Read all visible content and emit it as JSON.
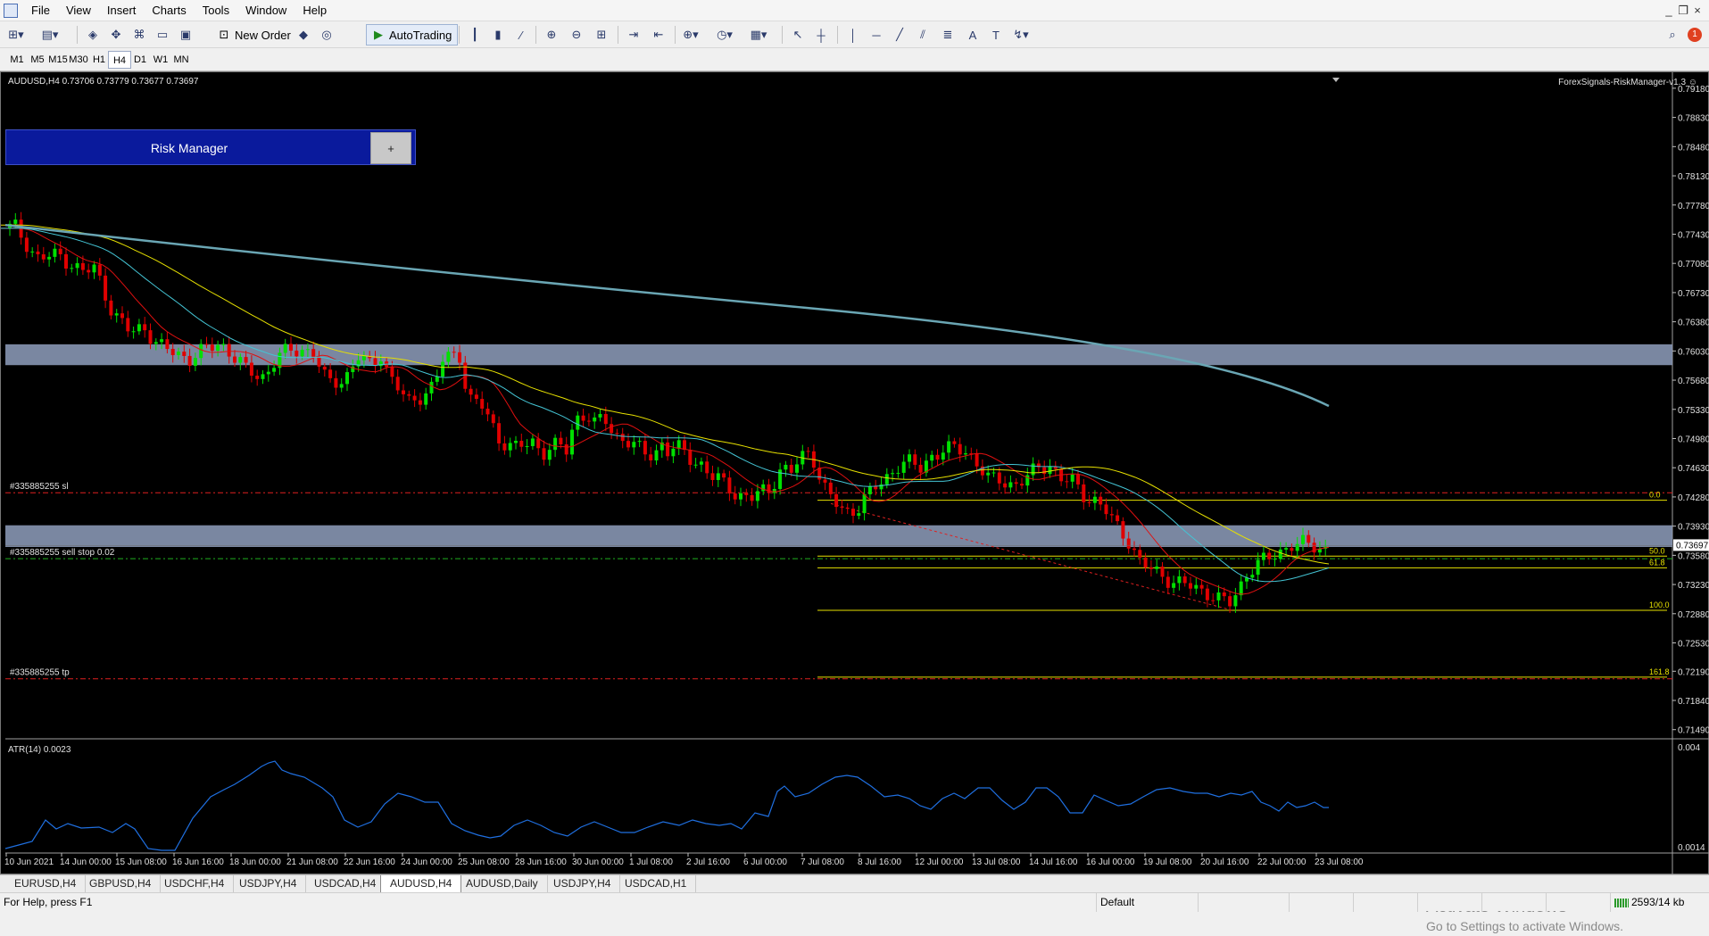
{
  "menu": {
    "items": [
      "File",
      "View",
      "Insert",
      "Charts",
      "Tools",
      "Window",
      "Help"
    ]
  },
  "window_controls": [
    "_",
    "❐",
    "×"
  ],
  "toolbar": {
    "new_order_label": "New Order",
    "autotrading_label": "AutoTrading",
    "notification_count": "1"
  },
  "timeframes": {
    "items": [
      "M1",
      "M5",
      "M15",
      "M30",
      "H1",
      "H4",
      "D1",
      "W1",
      "MN"
    ],
    "active": "H4"
  },
  "chart": {
    "symbol_info": "AUDUSD,H4  0.73706 0.73779 0.73677 0.73697",
    "ea_label": "ForexSignals-RiskManager-v1.3 ☺",
    "risk_manager": {
      "title": "Risk Manager",
      "toggle_label": "+"
    },
    "current_price": "0.73697",
    "price_axis": [
      "0.79180",
      "0.78830",
      "0.78480",
      "0.78130",
      "0.77780",
      "0.77430",
      "0.77080",
      "0.76730",
      "0.76380",
      "0.76030",
      "0.75680",
      "0.75330",
      "0.74980",
      "0.74630",
      "0.74280",
      "0.73930",
      "0.73580",
      "0.73230",
      "0.72880",
      "0.72530",
      "0.72190",
      "0.71840",
      "0.71490"
    ],
    "time_axis": [
      "10 Jun 2021",
      "14 Jun 00:00",
      "15 Jun 08:00",
      "16 Jun 16:00",
      "18 Jun 00:00",
      "21 Jun 08:00",
      "22 Jun 16:00",
      "24 Jun 00:00",
      "25 Jun 08:00",
      "28 Jun 16:00",
      "30 Jun 00:00",
      "1 Jul 08:00",
      "2 Jul 16:00",
      "6 Jul 00:00",
      "7 Jul 08:00",
      "8 Jul 16:00",
      "12 Jul 00:00",
      "13 Jul 08:00",
      "14 Jul 16:00",
      "16 Jul 00:00",
      "19 Jul 08:00",
      "20 Jul 16:00",
      "22 Jul 00:00",
      "23 Jul 08:00"
    ],
    "order_labels": {
      "sl": "#335885255 sl",
      "entry": "#335885255 sell stop 0.02",
      "tp": "#335885255 tp"
    },
    "fib_levels": [
      "0.0",
      "50.0",
      "61.8",
      "100.0",
      "161.8"
    ],
    "atr": {
      "label": "ATR(14) 0.0023",
      "axis": [
        "0.004",
        "0.0014"
      ]
    }
  },
  "colors": {
    "bull": "#00e000",
    "bear": "#e00000",
    "zone": "#8796b2",
    "ma_slow": "#6aa6b4",
    "ma_yellow": "#e6e000",
    "ma_cyan": "#44c4d4",
    "ma_red": "#e01010",
    "atr": "#1f6fe0",
    "fib": "#e6e000"
  },
  "tabs": {
    "items": [
      "EURUSD,H4",
      "GBPUSD,H4",
      "USDCHF,H4",
      "USDJPY,H4",
      "USDCAD,H4",
      "AUDUSD,H4",
      "AUDUSD,Daily",
      "USDJPY,H4",
      "USDCAD,H1"
    ],
    "active": "AUDUSD,H4"
  },
  "status": {
    "help": "For Help, press F1",
    "profile": "Default",
    "traffic": "2593/14 kb"
  },
  "watermark": {
    "title": "Activate Windows",
    "subtitle": "Go to Settings to activate Windows."
  }
}
